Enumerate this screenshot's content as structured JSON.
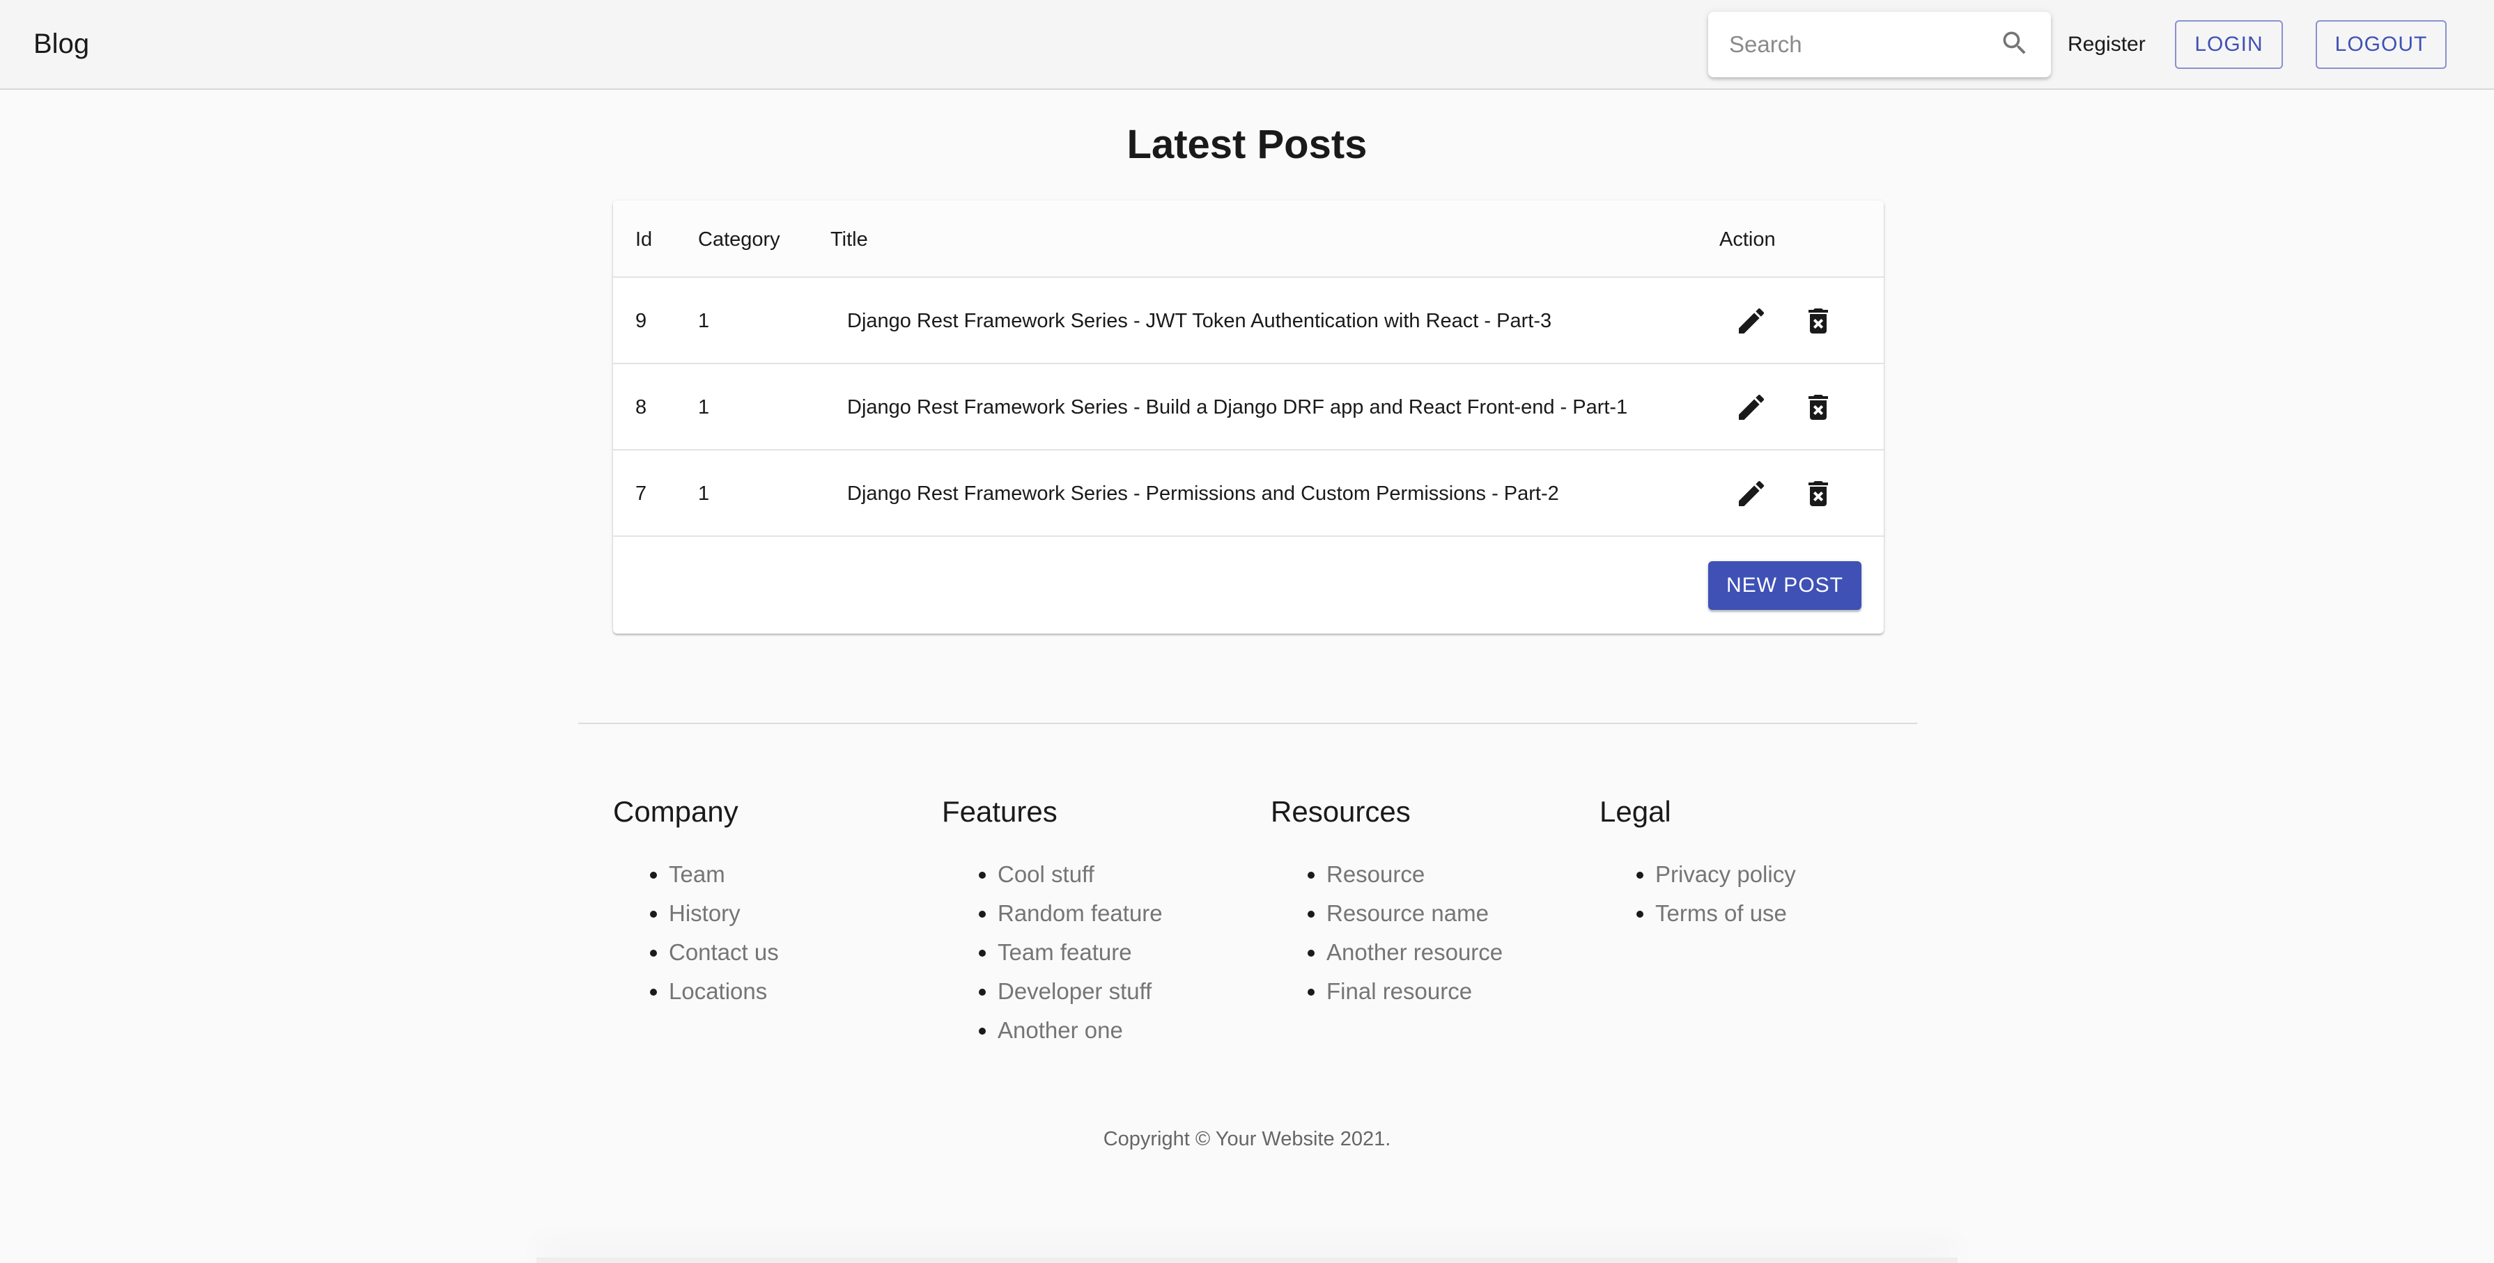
{
  "header": {
    "brand": "Blog",
    "search_placeholder": "Search",
    "search_value": "",
    "register_label": "Register",
    "login_label": "LOGIN",
    "logout_label": "LOGOUT"
  },
  "main": {
    "title": "Latest Posts",
    "table": {
      "columns": [
        "Id",
        "Category",
        "Title",
        "Action"
      ],
      "rows": [
        {
          "id": "9",
          "category": "1",
          "title": "Django Rest Framework Series - JWT Token Authentication with React - Part-3"
        },
        {
          "id": "8",
          "category": "1",
          "title": "Django Rest Framework Series - Build a Django DRF app and React Front-end - Part-1"
        },
        {
          "id": "7",
          "category": "1",
          "title": "Django Rest Framework Series - Permissions and Custom Permissions - Part-2"
        }
      ],
      "row_actions": [
        "edit-icon",
        "delete-forever-icon"
      ]
    },
    "new_post_label": "NEW POST"
  },
  "footer": {
    "columns": [
      {
        "heading": "Company",
        "items": [
          "Team",
          "History",
          "Contact us",
          "Locations"
        ]
      },
      {
        "heading": "Features",
        "items": [
          "Cool stuff",
          "Random feature",
          "Team feature",
          "Developer stuff",
          "Another one"
        ]
      },
      {
        "heading": "Resources",
        "items": [
          "Resource",
          "Resource name",
          "Another resource",
          "Final resource"
        ]
      },
      {
        "heading": "Legal",
        "items": [
          "Privacy policy",
          "Terms of use"
        ]
      }
    ],
    "copyright": "Copyright © Your Website 2021."
  },
  "colors": {
    "primary": "#3f51b5",
    "appbar_bg": "#f5f5f5",
    "page_bg": "#fafafa",
    "muted_text": "#757575"
  }
}
